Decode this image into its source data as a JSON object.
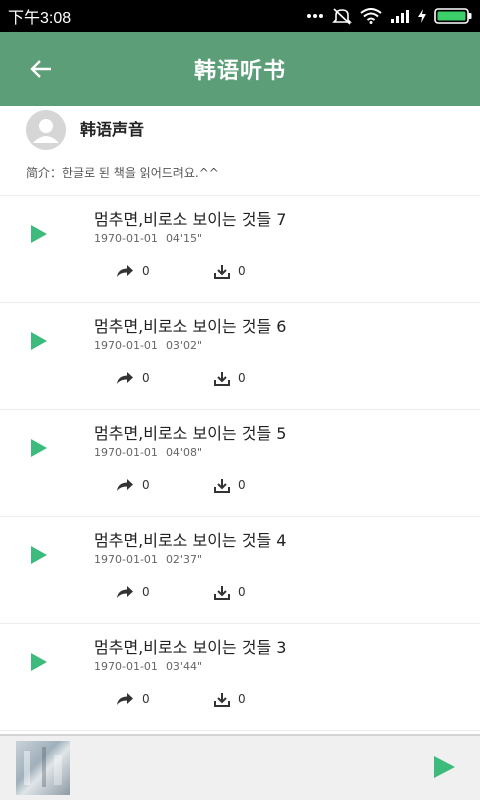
{
  "status_bar": {
    "time": "下午3:08"
  },
  "app_bar": {
    "title": "韩语听书"
  },
  "channel": {
    "name": "韩语声音",
    "intro": "简介：한글로 된 책을 읽어드려요.^^"
  },
  "tracks": [
    {
      "title": "멈추면,비로소 보이는 것들 7",
      "date": "1970-01-01",
      "duration": "04'15\"",
      "shares": "0",
      "downloads": "0"
    },
    {
      "title": "멈추면,비로소 보이는 것들 6",
      "date": "1970-01-01",
      "duration": "03'02\"",
      "shares": "0",
      "downloads": "0"
    },
    {
      "title": "멈추면,비로소 보이는 것들 5",
      "date": "1970-01-01",
      "duration": "04'08\"",
      "shares": "0",
      "downloads": "0"
    },
    {
      "title": "멈추면,비로소 보이는 것들 4",
      "date": "1970-01-01",
      "duration": "02'37\"",
      "shares": "0",
      "downloads": "0"
    },
    {
      "title": "멈추면,비로소 보이는 것들 3",
      "date": "1970-01-01",
      "duration": "03'44\"",
      "shares": "0",
      "downloads": "0"
    }
  ],
  "icons": {
    "back": "arrow-left-icon",
    "play": "play-icon",
    "share": "share-icon",
    "download": "download-icon",
    "avatar": "user-icon"
  },
  "colors": {
    "app_bar": "#5b9e78",
    "accent_play": "#3dbb7c",
    "status_bar": "#000000"
  }
}
